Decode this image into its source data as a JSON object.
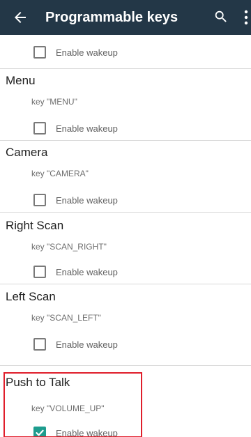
{
  "app_bar": {
    "title": "Programmable keys",
    "back_icon": "arrow-left-icon",
    "search_icon": "search-icon",
    "overflow_icon": "more-vert-icon"
  },
  "top_partial": {
    "wakeup_label": "Enable wakeup",
    "wakeup_checked": false
  },
  "keys": [
    {
      "title": "Menu",
      "code": "key \"MENU\"",
      "wakeup_label": "Enable wakeup",
      "wakeup_checked": false
    },
    {
      "title": "Camera",
      "code": "key \"CAMERA\"",
      "wakeup_label": "Enable wakeup",
      "wakeup_checked": false
    },
    {
      "title": "Right Scan",
      "code": "key \"SCAN_RIGHT\"",
      "wakeup_label": "Enable wakeup",
      "wakeup_checked": false
    },
    {
      "title": "Left Scan",
      "code": "key \"SCAN_LEFT\"",
      "wakeup_label": "Enable wakeup",
      "wakeup_checked": false
    },
    {
      "title": "Push to Talk",
      "code": "key \"VOLUME_UP\"",
      "wakeup_label": "Enable wakeup",
      "wakeup_checked": true
    }
  ],
  "colors": {
    "app_bar": "#233747",
    "accent": "#1d9d8e",
    "highlight": "#e01e2b"
  }
}
